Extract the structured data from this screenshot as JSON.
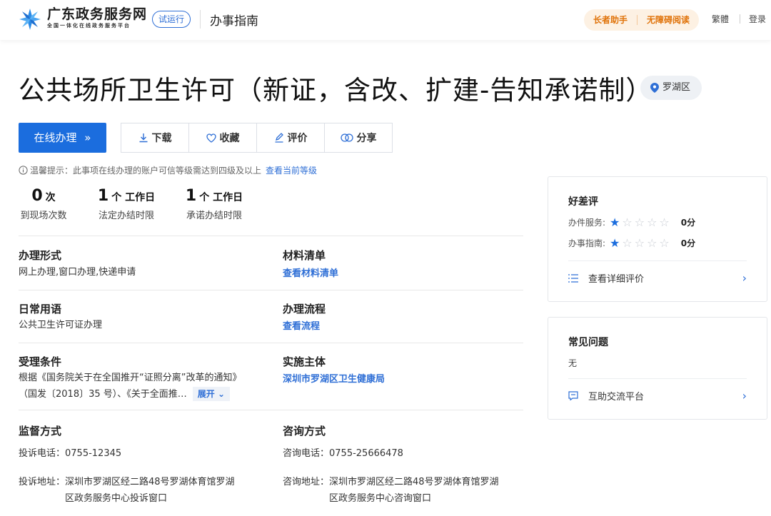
{
  "header": {
    "brand_title": "广东政务服务网",
    "brand_sub": "全国一体化在线政务服务平台",
    "trial_badge": "试运行",
    "guide_title": "办事指南",
    "elder_helper": "长者助手",
    "accessible_reading": "无障碍阅读",
    "traditional": "繁體",
    "login": "登录"
  },
  "page": {
    "title": "公共场所卫生许可（新证，含改、扩建-告知承诺制）",
    "region": "罗湖区"
  },
  "actions": {
    "online": "在线办理",
    "download": "下载",
    "favorite": "收藏",
    "evaluate": "评价",
    "share": "分享"
  },
  "tip": {
    "text": "温馨提示：此事项在线办理的账户可信等级需达到四级及以上",
    "link": "查看当前等级"
  },
  "stats": [
    {
      "value": "0",
      "unit": "次",
      "label": "到现场次数"
    },
    {
      "value": "1",
      "unit": "个 工作日",
      "label": "法定办结时限"
    },
    {
      "value": "1",
      "unit": "个 工作日",
      "label": "承诺办结时限"
    }
  ],
  "sections": {
    "form_label": "办理形式",
    "form_value": "网上办理,窗口办理,快递申请",
    "materials_label": "材料清单",
    "materials_link": "查看材料清单",
    "common_label": "日常用语",
    "common_value": "公共卫生许可证办理",
    "process_label": "办理流程",
    "process_link": "查看流程",
    "conditions_label": "受理条件",
    "conditions_line1": "根据《国务院关于在全国推开“证照分离”改革的通知》",
    "conditions_line2": "（国发〔2018〕35 号）、《关于全面推…",
    "expand": "展开",
    "subject_label": "实施主体",
    "subject_link": "深圳市罗湖区卫生健康局",
    "supervision_label": "监督方式",
    "complaint_phone": "投诉电话：0755-12345",
    "complaint_addr_key": "投诉地址：",
    "complaint_addr_line1": "深圳市罗湖区经二路48号罗湖体育馆罗湖",
    "complaint_addr_line2": "区政务服务中心投诉窗口",
    "consult_label": "咨询方式",
    "consult_phone": "咨询电话：0755-25666478",
    "consult_addr_key": "咨询地址：",
    "consult_addr_line1": "深圳市罗湖区经二路48号罗湖体育馆罗湖",
    "consult_addr_line2": "区政务服务中心咨询窗口"
  },
  "rating_card": {
    "title": "好差评",
    "service_label": "办件服务:",
    "service_stars": 1,
    "service_score": "0分",
    "guide_label": "办事指南:",
    "guide_stars": 1,
    "guide_score": "0分",
    "detail_link": "查看详细评价"
  },
  "faq_card": {
    "title": "常见问题",
    "content": "无",
    "link": "互助交流平台"
  },
  "colors": {
    "primary": "#1b6dde",
    "link": "#2f6fd6",
    "elder": "#e0730a"
  }
}
